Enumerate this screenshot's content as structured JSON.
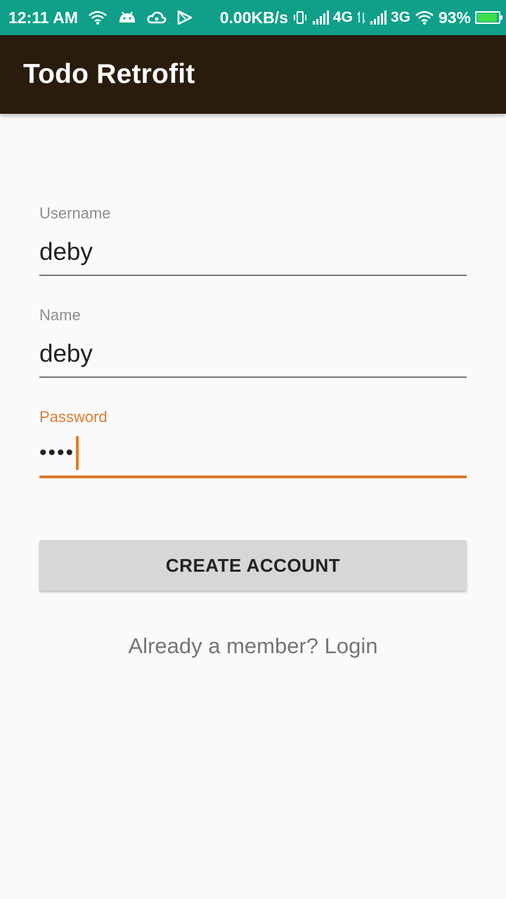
{
  "status_bar": {
    "time": "12:11 AM",
    "net_speed": "0.00KB/s",
    "network_1": "4G",
    "network_2": "3G",
    "battery": "93%",
    "battery_level": 0.93,
    "icons": [
      "wifi-icon",
      "android-icon",
      "cloud-icon",
      "play-store-icon",
      "vibrate-icon",
      "signal-icon",
      "data-arrows-icon",
      "signal-icon",
      "wifi-icon",
      "battery-icon"
    ]
  },
  "app_bar": {
    "title": "Todo Retrofit"
  },
  "form": {
    "username": {
      "label": "Username",
      "value": "deby"
    },
    "name": {
      "label": "Name",
      "value": "deby"
    },
    "password": {
      "label": "Password",
      "masked_value": "••••"
    }
  },
  "create_button": {
    "label": "CREATE ACCOUNT"
  },
  "login_link": {
    "label": "Already a member? Login"
  },
  "colors": {
    "status_bar": "#10a08a",
    "app_bar": "#2a1c0c",
    "accent": "#dc7d2f",
    "button": "#d7d7d7"
  }
}
